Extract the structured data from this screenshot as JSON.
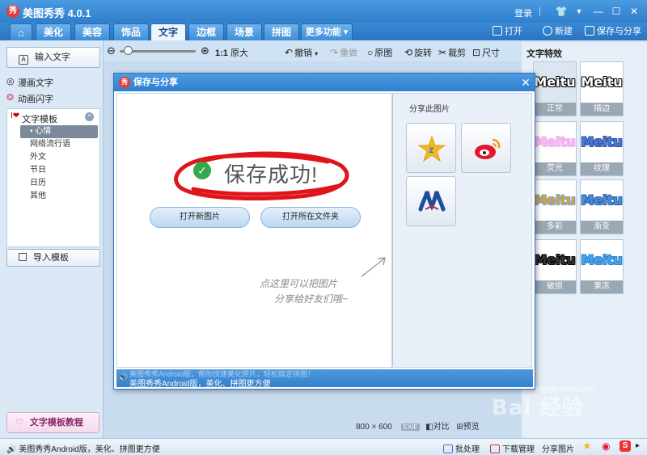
{
  "app": {
    "title": "美图秀秀 4.0.1",
    "logo_char": "秀",
    "login_label": "登录",
    "separator": "|",
    "window_buttons": {
      "shirt": "👕",
      "menu": "▼",
      "minimize": "—",
      "maximize": "☐",
      "close": "✕"
    }
  },
  "tabs": [
    {
      "label": "⌂",
      "name": "home"
    },
    {
      "label": "美化",
      "name": "beautify"
    },
    {
      "label": "美容",
      "name": "beauty"
    },
    {
      "label": "饰品",
      "name": "accessories"
    },
    {
      "label": "文字",
      "name": "text",
      "active": true
    },
    {
      "label": "边框",
      "name": "border"
    },
    {
      "label": "场景",
      "name": "scene"
    },
    {
      "label": "拼图",
      "name": "collage"
    },
    {
      "label": "更多功能 ▾",
      "name": "more"
    }
  ],
  "toolbar_right": {
    "open": "打开",
    "new": "新建",
    "save_share": "保存与分享"
  },
  "toolbar": {
    "zoom_out": "⊖",
    "zoom_in": "⊕",
    "zoom_level": 0.05,
    "ratio": "1:1",
    "original_size": "原大",
    "undo": "撤销",
    "undo_arrow": "▾",
    "redo": "重做",
    "original": "原图",
    "rotate": "旋转",
    "crop": "裁剪",
    "size": "尺寸"
  },
  "left_panel": {
    "input_text": "输入文字",
    "input_icon": "A",
    "comic_text": "漫画文字",
    "flash_text": "动画闪字",
    "template_header": "文字模板",
    "template_icon": "I❤",
    "template_collapse": "^",
    "templates": [
      {
        "label": "• 心情",
        "selected": true
      },
      {
        "label": "网络流行语"
      },
      {
        "label": "外文"
      },
      {
        "label": "节日"
      },
      {
        "label": "日历"
      },
      {
        "label": "其他"
      }
    ],
    "import_template": "导入模板",
    "tutorial": "文字模板教程",
    "tutorial_icon": "♡"
  },
  "right_panel": {
    "title": "文字特效",
    "effects": [
      {
        "label": "正常",
        "preview": "Meitu",
        "color": "#ffffff",
        "stroke": "#000000",
        "bg": "#dbe6f0"
      },
      {
        "label": "描边",
        "preview": "Meitu",
        "color": "#ffffff",
        "stroke": "#000000",
        "bg": "#ffffff"
      },
      {
        "label": "荧光",
        "preview": "Meitu",
        "color": "#f3b8f0",
        "stroke": "#f2b6f0",
        "bg": "#ffffff"
      },
      {
        "label": "纹理",
        "preview": "Meitu",
        "color": "#4a7bd9",
        "stroke": "#304e9a",
        "bg": "#ffffff"
      },
      {
        "label": "多彩",
        "preview": "Meitu",
        "color": "#e0a030",
        "stroke": "#6aa9e0",
        "bg": "#ffffff"
      },
      {
        "label": "渐变",
        "preview": "Meitu",
        "color": "#4a8fd9",
        "stroke": "#2b5fa3",
        "bg": "#ffffff"
      },
      {
        "label": "破损",
        "preview": "Meitu",
        "color": "#333333",
        "stroke": "#000000",
        "bg": "#ffffff"
      },
      {
        "label": "果冻",
        "preview": "Meitu",
        "color": "#49a6e6",
        "stroke": "#2f7fcb",
        "bg": "#ffffff"
      }
    ]
  },
  "dialog": {
    "title": "保存与分享",
    "close": "✕",
    "success": "保存成功!",
    "check": "✓",
    "open_new": "打开新图片",
    "open_folder": "打开所在文件夹",
    "hint_line1": "点这里可以把图片",
    "hint_line2": "分享给好友们哦~",
    "share_title": "分享此图片",
    "footer_line1": "美图秀秀Android版，帮你快速美化照片，轻松搞定拼图！",
    "footer_line2": "美图秀秀Android版，美化、拼图更方便",
    "speaker": "🔊"
  },
  "canvas_info": {
    "width": "800",
    "height": "600",
    "times": "×",
    "exif": "EXIF",
    "compare": "对比",
    "preview": "预览"
  },
  "statusbar": {
    "message": "美图秀秀Android版，美化、拼图更方便",
    "batch": "批处理",
    "downloads": "下载管理",
    "share_image": "分享图片"
  },
  "watermark": {
    "text": "Bai 经验",
    "url": "jingyan.baidu.com"
  },
  "colors": {
    "title_bar": "#2f7fcb",
    "success_green": "#35a84a",
    "scribble_red": "#e0151b"
  }
}
